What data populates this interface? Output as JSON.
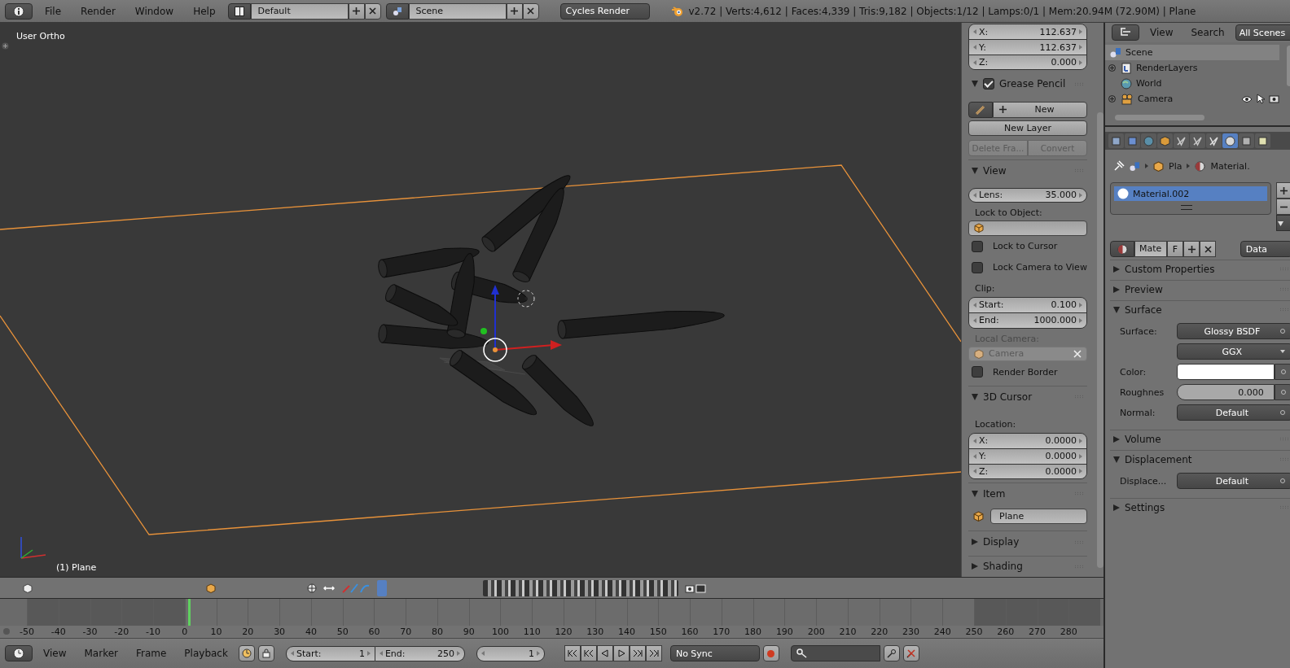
{
  "topbar": {
    "menus": [
      "File",
      "Render",
      "Window",
      "Help"
    ],
    "layout": "Default",
    "scene": "Scene",
    "engine": "Cycles Render",
    "stats": "v2.72 | Verts:4,612 | Faces:4,339 | Tris:9,182 | Objects:1/12 | Lamps:0/1 | Mem:20.94M (72.90M) | Plane"
  },
  "viewport": {
    "view_name": "User Ortho",
    "object_label": "(1) Plane"
  },
  "npanel": {
    "transform": [
      {
        "label": "X:",
        "value": "112.637"
      },
      {
        "label": "Y:",
        "value": "112.637"
      },
      {
        "label": "Z:",
        "value": "0.000"
      }
    ],
    "grease_pencil": {
      "title": "Grease Pencil",
      "expanded": true,
      "checked": true,
      "new_button": "New",
      "new_layer": "New Layer",
      "actions": [
        {
          "label": "Delete Fra...",
          "disabled": true
        },
        {
          "label": "Convert",
          "disabled": true
        }
      ]
    },
    "view": {
      "title": "View",
      "expanded": true,
      "lens": {
        "label": "Lens:",
        "value": "35.000"
      },
      "lock_object_label": "Lock to Object:",
      "toggles": [
        {
          "label": "Lock to Cursor",
          "checked": false
        },
        {
          "label": "Lock Camera to View",
          "checked": false
        }
      ],
      "clip_label": "Clip:",
      "clip": [
        {
          "label": "Start:",
          "value": "0.100"
        },
        {
          "label": "End:",
          "value": "1000.000"
        }
      ],
      "local_camera_label": "Local Camera:",
      "local_camera": "Camera",
      "render_border": {
        "label": "Render Border",
        "checked": false
      }
    },
    "cursor": {
      "title": "3D Cursor",
      "expanded": true,
      "location_label": "Location:",
      "fields": [
        {
          "label": "X:",
          "value": "0.0000"
        },
        {
          "label": "Y:",
          "value": "0.0000"
        },
        {
          "label": "Z:",
          "value": "0.0000"
        }
      ]
    },
    "item": {
      "title": "Item",
      "expanded": true,
      "name": "Plane"
    },
    "collapsed": [
      {
        "title": "Display",
        "expanded": false
      },
      {
        "title": "Shading",
        "expanded": false
      }
    ]
  },
  "outliner": {
    "menus": [
      "View",
      "Search"
    ],
    "filter": "All Scenes",
    "tree": [
      {
        "name": "Scene",
        "selected": true,
        "children": [
          {
            "name": "RenderLayers",
            "selected": false,
            "expanded": false
          },
          {
            "name": "World",
            "selected": false
          },
          {
            "name": "Camera",
            "selected": false,
            "expanded": false
          }
        ]
      }
    ]
  },
  "properties": {
    "tabs": [
      {
        "selected": false
      },
      {
        "selected": false
      },
      {
        "selected": false
      },
      {
        "selected": false
      },
      {
        "selected": false
      },
      {
        "selected": false
      },
      {
        "selected": false
      },
      {
        "selected": true
      },
      {
        "selected": false
      },
      {
        "selected": false
      }
    ],
    "breadcrumb": [
      "Pla",
      "Material."
    ],
    "slots": [
      {
        "name": "Material.002",
        "selected": true
      }
    ],
    "datablock": {
      "name": "Mate",
      "users": "F",
      "link": "Data"
    },
    "panels": [
      {
        "title": "Custom Properties",
        "expanded": false
      },
      {
        "title": "Preview",
        "expanded": false
      },
      {
        "title": "Surface",
        "expanded": true,
        "rows": [
          {
            "kind": "socket",
            "label": "Surface:",
            "value": "Glossy BSDF"
          },
          {
            "kind": "dropdown",
            "value": "GGX"
          },
          {
            "kind": "color",
            "label": "Color:",
            "color": "#ffffff"
          },
          {
            "kind": "slider",
            "label": "Roughnes",
            "value": "0.000",
            "level": 0
          },
          {
            "kind": "socket",
            "label": "Normal:",
            "value": "Default"
          }
        ]
      },
      {
        "title": "Volume",
        "expanded": false
      },
      {
        "title": "Displacement",
        "expanded": true,
        "rows": [
          {
            "kind": "socket",
            "label": "Displace...",
            "value": "Default"
          }
        ]
      },
      {
        "title": "Settings",
        "expanded": false
      }
    ]
  },
  "timeline": {
    "ticks": [
      "-50",
      "-40",
      "-30",
      "-20",
      "-10",
      "0",
      "10",
      "20",
      "30",
      "40",
      "50",
      "60",
      "70",
      "80",
      "90",
      "100",
      "110",
      "120",
      "130",
      "140",
      "150",
      "160",
      "170",
      "180",
      "190",
      "200",
      "210",
      "220",
      "230",
      "240",
      "250",
      "260",
      "270",
      "280"
    ],
    "menus": [
      "View",
      "Marker",
      "Frame",
      "Playback"
    ],
    "start": {
      "label": "Start:",
      "value": "1"
    },
    "end": {
      "label": "End:",
      "value": "250"
    },
    "current": "1",
    "sync": "No Sync"
  }
}
